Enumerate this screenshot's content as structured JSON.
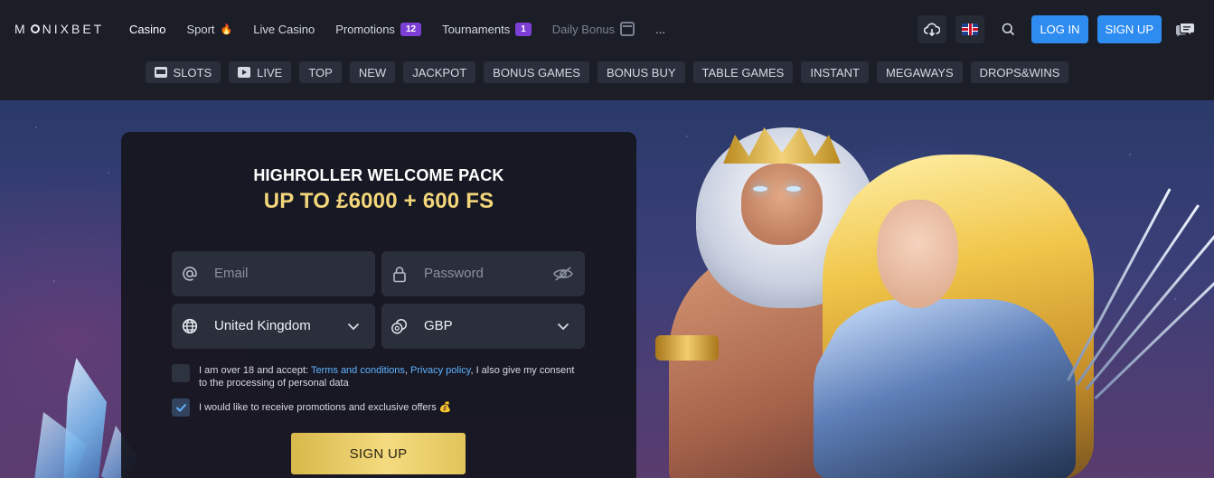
{
  "header": {
    "logo": {
      "prefix": "M",
      "suffix": "NIXBET"
    },
    "nav": [
      {
        "label": "Casino"
      },
      {
        "label": "Sport"
      },
      {
        "label": "Live Casino"
      },
      {
        "label": "Promotions",
        "badge": "12"
      },
      {
        "label": "Tournaments",
        "badge": "1"
      },
      {
        "label": "Daily Bonus"
      },
      {
        "label": "..."
      }
    ],
    "login_label": "LOG IN",
    "signup_label": "SIGN UP"
  },
  "categories": [
    {
      "label": "SLOTS",
      "icon": "slots-icon"
    },
    {
      "label": "LIVE",
      "icon": "live-icon"
    },
    {
      "label": "TOP"
    },
    {
      "label": "NEW"
    },
    {
      "label": "JACKPOT"
    },
    {
      "label": "BONUS GAMES"
    },
    {
      "label": "BONUS BUY"
    },
    {
      "label": "TABLE GAMES"
    },
    {
      "label": "INSTANT"
    },
    {
      "label": "MEGAWAYS"
    },
    {
      "label": "DROPS&WINS"
    }
  ],
  "signup_panel": {
    "title": "HIGHROLLER WELCOME PACK",
    "offer": "UP TO £6000 + 600 FS",
    "email_placeholder": "Email",
    "password_placeholder": "Password",
    "country": "United Kingdom",
    "currency": "GBP",
    "terms": {
      "prefix": "I am over 18 and accept: ",
      "link1": "Terms and conditions",
      "sep": ", ",
      "link2": "Privacy policy",
      "suffix": ", I also give my consent to the processing of personal data",
      "checked": false
    },
    "promo": {
      "label": "I would like to receive promotions and exclusive offers",
      "checked": true
    },
    "submit_label": "SIGN UP"
  },
  "colors": {
    "accent_blue": "#2e8cf0",
    "badge_purple": "#7c3fd6",
    "gold": "#f4d67a",
    "link": "#5fb3ff"
  }
}
